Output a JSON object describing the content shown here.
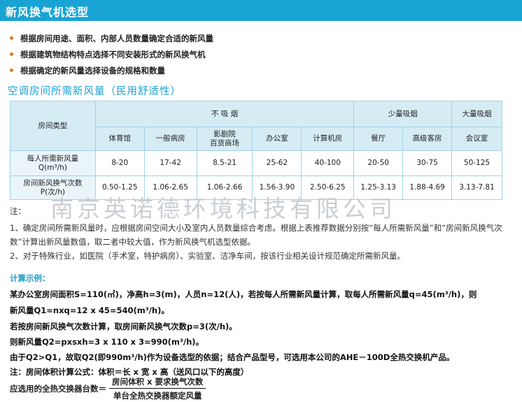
{
  "header": {
    "title": "新风换气机选型"
  },
  "bullets": [
    "根据房间用途、面积、内部人员数量确定合适的新风量",
    "根据建筑物结构特点选择不同安装形式的新风换气机",
    "根据确定的新风量选择设备的规格和数量"
  ],
  "subtitle": "空调房间所需新风量（民用舒适性）",
  "table": {
    "row_header": "房间类型",
    "groups": [
      "不 吸 烟",
      "少量吸烟",
      "大量吸烟"
    ],
    "rooms": [
      "体育馆",
      "一般病房",
      "影剧院\n百货商场",
      "办公室",
      "计算机房",
      "餐厅",
      "高级客房",
      "会议室"
    ],
    "rows": [
      {
        "label": "每人所需新风量\nQ(m³/h)",
        "values": [
          "8-20",
          "17-42",
          "8.5-21",
          "25-62",
          "40-100",
          "20-50",
          "30-75",
          "50-125"
        ]
      },
      {
        "label": "房间新风换气次数\nP(次/h)",
        "values": [
          "0.50-1.25",
          "1.06-2.65",
          "1.06-2.66",
          "1.56-3.90",
          "2.50-6.25",
          "1.25-3.13",
          "1.88-4.69",
          "3.13-7.81"
        ]
      }
    ]
  },
  "watermark": "南京英诺德环境科技有限公司",
  "notes": {
    "title": "注：",
    "n1": "1、确定房间所需新风量时，应根据房间空间大小及室内人员数量综合考虑。根据上表推荐数据分别按“每人所需新风量”和“房间新风换气次数”计算出新风量数值，取二者中较大值，作为新风换气机选型依据。",
    "n2": "2、对于特殊行业，如医院（手术室，特护病房）、实验室、洁净车间，按该行业相关设计规范确定所需新风量。"
  },
  "calc": {
    "title": "计算示例：",
    "lines": [
      "某办公室房间面积S=110(㎡)，净高h=3(m)，人员n=12(人)，若按每人所需新风量计算，取每人所需新风量q=45(m³/h)，则",
      "新风量Q1=nxq=12 x 45=540(m³/h)。",
      "若按房间新风换气次数计算，取房间新风换气次数p=3(次/h)。",
      "则新风量Q2=pxsxh=3 x 110 x 3=990(m³/h)。",
      "由于Q2>Q1，故取Q2(即990m³/h)作为设备选型的依据；结合产品型号，可选用本公司的AHE－100D全热交换机产品。",
      "注：房间体积计算公式：体积＝长 x 宽 x 高（送风口以下的高度）"
    ],
    "formula_label": "应选用的全热交换器台数＝",
    "formula_num": "房间体积 x 要求换气次数",
    "formula_den": "单台全热交换器额定风量"
  }
}
